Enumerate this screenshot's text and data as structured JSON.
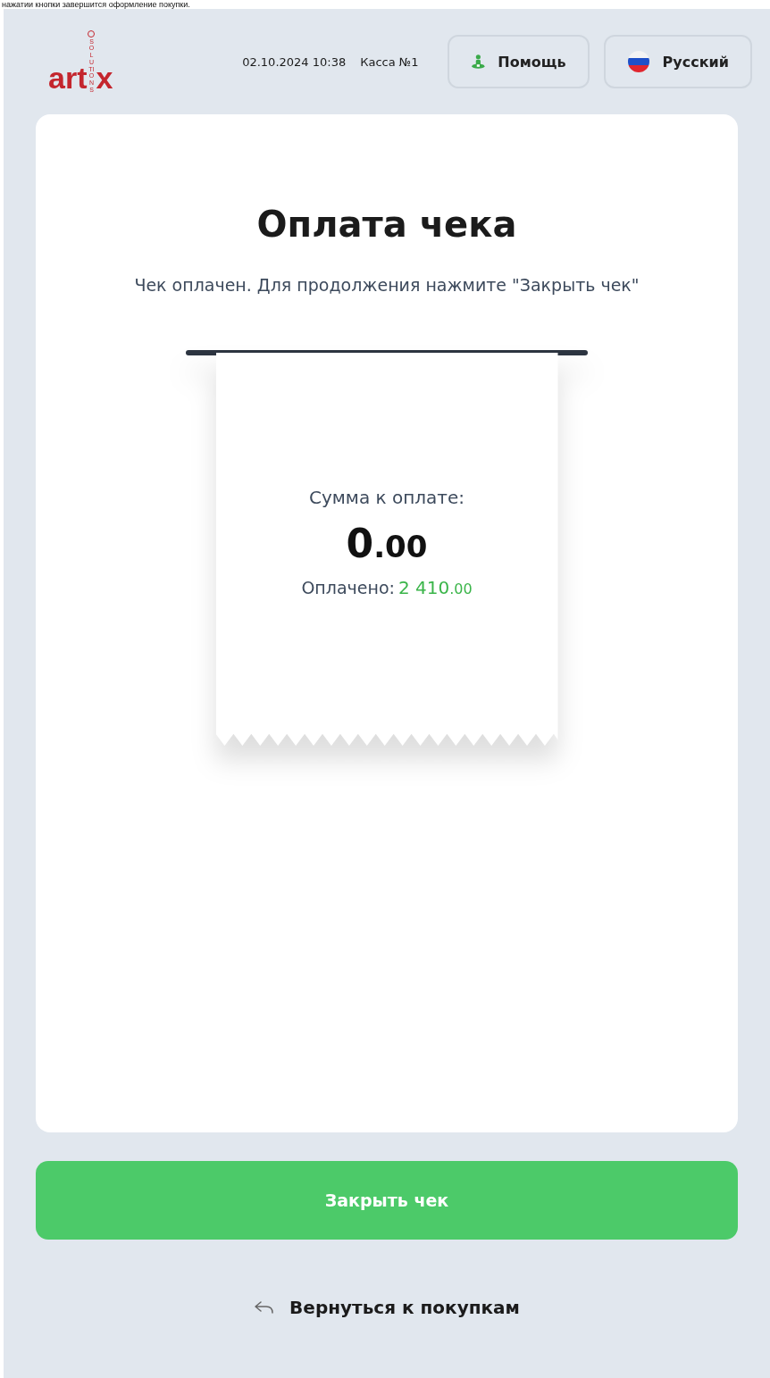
{
  "top_caption": "нажатии кнопки завершится оформление покупки.",
  "header": {
    "logo": {
      "left": "art",
      "right": "x",
      "tagline": "SOLUTIONS"
    },
    "datetime": "02.10.2024 10:38",
    "register": "Касса №1",
    "help_button": "Помощь",
    "language_button": "Русский"
  },
  "title": "Оплата чека",
  "subtitle": "Чек оплачен. Для продолжения нажмите \"Закрыть чек\"",
  "receipt": {
    "due_label": "Сумма к оплате:",
    "due_integer": "0",
    "due_fraction": ".00",
    "paid_label": "Оплачено:",
    "paid_integer": "2 410",
    "paid_fraction": ".00"
  },
  "close_button": "Закрыть чек",
  "back_link": "Вернуться к покупкам"
}
